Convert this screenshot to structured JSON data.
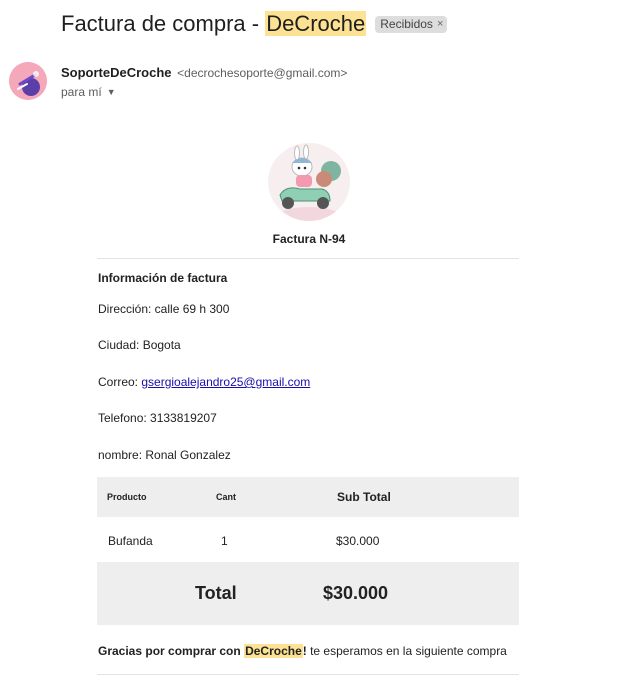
{
  "email": {
    "subject_prefix": "Factura de compra - ",
    "subject_highlight": "DeCroche",
    "label": "Recibidos",
    "label_remove": "×",
    "sender_name": "SoporteDeCroche",
    "sender_email": "<decrochesoporte@gmail.com>",
    "to": "para mí"
  },
  "invoice": {
    "title": "Factura N-94",
    "section_title": "Información de factura",
    "address": "Dirección: calle 69 h 300",
    "city": "Ciudad: Bogota",
    "email_label": "Correo: ",
    "email_value": "gsergioalejandro25@gmail.com",
    "phone": "Telefono: 3133819207",
    "name": "nombre: Ronal Gonzalez",
    "table": {
      "headers": [
        "Producto",
        "Cant",
        "Sub Total"
      ],
      "rows": [
        {
          "product": "Bufanda",
          "qty": "1",
          "subtotal": "$30.000"
        }
      ]
    },
    "total_label": "Total",
    "total_value": "$30.000",
    "thanks_prefix": "Gracias por comprar con ",
    "thanks_brand": "DeCroche",
    "thanks_mid": "!",
    "thanks_suffix": " te esperamos en la siguiente compra"
  },
  "colors": {
    "highlight": "#fde293",
    "link": "#1a0dab",
    "table_bg": "#eeeeee",
    "chip_bg": "#dddddd",
    "avatar_bg": "#f2a2b6"
  },
  "icons": [
    "sender-avatar-icon",
    "dropdown-caret-icon",
    "bunny-scooter-logo"
  ]
}
